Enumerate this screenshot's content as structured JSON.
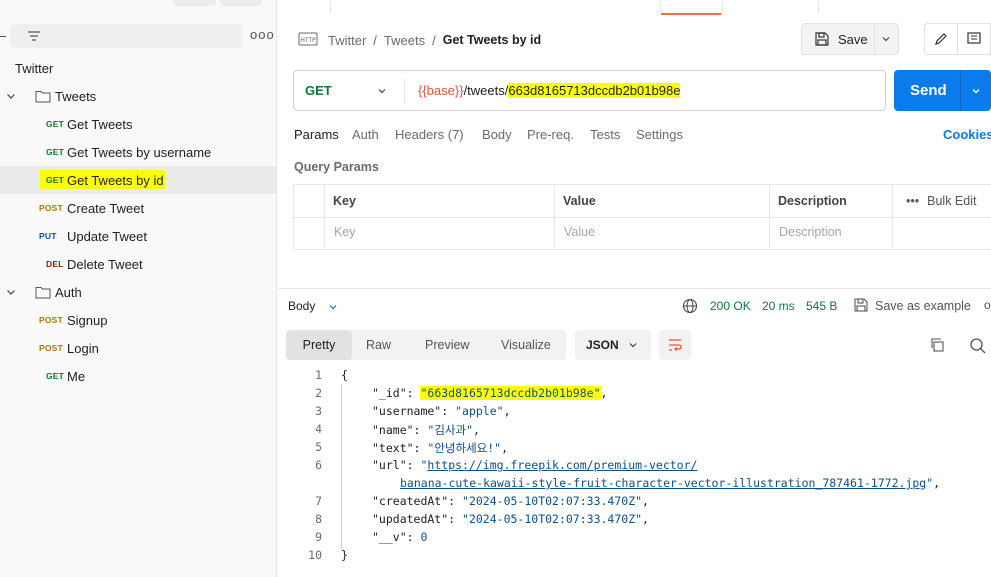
{
  "sidebar": {
    "more_label": "ooo",
    "tree": [
      {
        "type": "collection",
        "label": "Twitter"
      },
      {
        "type": "folder",
        "label": "Tweets"
      },
      {
        "type": "request",
        "method": "GET",
        "label": "Get Tweets"
      },
      {
        "type": "request",
        "method": "GET",
        "label": "Get Tweets by username"
      },
      {
        "type": "request",
        "method": "GET",
        "label": "Get Tweets by id",
        "active": true,
        "highlighted": true
      },
      {
        "type": "request",
        "method": "POST",
        "label": "Create Tweet"
      },
      {
        "type": "request",
        "method": "PUT",
        "label": "Update Tweet"
      },
      {
        "type": "request",
        "method": "DEL",
        "label": "Delete Tweet"
      },
      {
        "type": "folder",
        "label": "Auth"
      },
      {
        "type": "request",
        "method": "POST",
        "label": "Signup"
      },
      {
        "type": "request",
        "method": "POST",
        "label": "Login"
      },
      {
        "type": "request",
        "method": "GET",
        "label": "Me"
      }
    ]
  },
  "breadcrumb": {
    "icon": "http-icon",
    "items": [
      "Twitter",
      "Tweets"
    ],
    "separator": "/",
    "current": "Get Tweets by id"
  },
  "toolbar": {
    "save_label": "Save"
  },
  "request": {
    "method": "GET",
    "url_variable": "{{base}}",
    "url_path": "/tweets/",
    "url_id": "663d8165713dccdb2b01b98e",
    "send_label": "Send"
  },
  "request_tabs": [
    "Params",
    "Auth",
    "Headers (7)",
    "Body",
    "Pre-req.",
    "Tests",
    "Settings"
  ],
  "cookies_label": "Cookies",
  "query_params": {
    "title": "Query Params",
    "headers": [
      "Key",
      "Value",
      "Description"
    ],
    "placeholders": [
      "Key",
      "Value",
      "Description"
    ],
    "bulk_edit_label": "Bulk Edit",
    "bulk_more": "•••"
  },
  "response": {
    "body_label": "Body",
    "status": "200 OK",
    "time": "20 ms",
    "size": "545 B",
    "save_example_label": "Save as example",
    "more": "ooo",
    "view_tabs": [
      "Pretty",
      "Raw",
      "Preview",
      "Visualize"
    ],
    "format": "JSON",
    "lines": [
      {
        "n": "1",
        "text": "{"
      },
      {
        "n": "2",
        "key": "\"_id\"",
        "value": "\"663d8165713dccdb2b01b98e\"",
        "tail": ","
      },
      {
        "n": "3",
        "key": "\"username\"",
        "value": "\"apple\"",
        "tail": ","
      },
      {
        "n": "4",
        "key": "\"name\"",
        "value": "\"김사과\"",
        "tail": ","
      },
      {
        "n": "5",
        "key": "\"text\"",
        "value": "\"안녕하세요!\"",
        "tail": ","
      },
      {
        "n": "6",
        "key": "\"url\"",
        "value_prefix": "\"",
        "link1": "https://img.freepik.com/premium-vector/",
        "link2": "banana-cute-kawaii-style-fruit-character-vector-illustration_787461-1772.jpg",
        "value_suffix": "\"",
        "tail": ","
      },
      {
        "n": "7",
        "key": "\"createdAt\"",
        "value": "\"2024-05-10T02:07:33.470Z\"",
        "tail": ","
      },
      {
        "n": "8",
        "key": "\"updatedAt\"",
        "value": "\"2024-05-10T02:07:33.470Z\"",
        "tail": ","
      },
      {
        "n": "9",
        "key": "\"__v\"",
        "value": "0",
        "tail": ""
      },
      {
        "n": "10",
        "text": "}"
      }
    ]
  },
  "colors": {
    "accent": "#ff6c37",
    "send": "#097bed",
    "get": "#0a7a3a",
    "post": "#ad7a03",
    "put": "#0053b8",
    "delete": "#8e1a10",
    "highlight": "#ffff00",
    "status_ok": "#0a7a3a"
  }
}
